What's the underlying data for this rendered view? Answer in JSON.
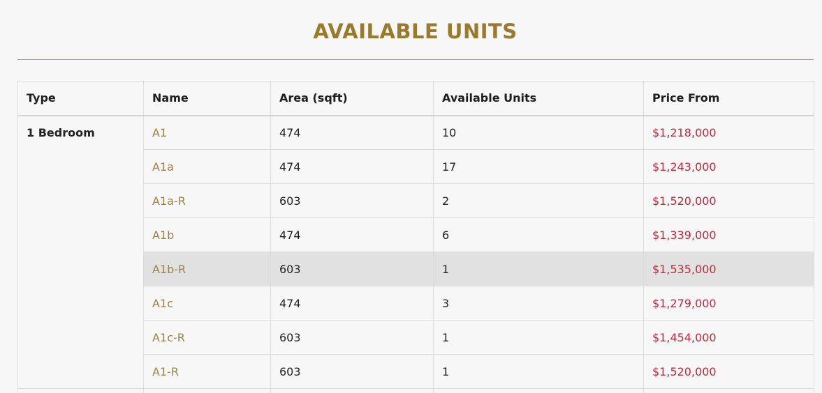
{
  "page": {
    "title": "AVAILABLE UNITS"
  },
  "table": {
    "headers": [
      "Type",
      "Name",
      "Area (sqft)",
      "Available Units",
      "Price From"
    ],
    "group_type": "1 Bedroom",
    "rows": [
      {
        "name": "A1",
        "area": "474",
        "units": "10",
        "price": "$1,218,000"
      },
      {
        "name": "A1a",
        "area": "474",
        "units": "17",
        "price": "$1,243,000"
      },
      {
        "name": "A1a-R",
        "area": "603",
        "units": "2",
        "price": "$1,520,000"
      },
      {
        "name": "A1b",
        "area": "474",
        "units": "6",
        "price": "$1,339,000"
      },
      {
        "name": "A1b-R",
        "area": "603",
        "units": "1",
        "price": "$1,535,000"
      },
      {
        "name": "A1c",
        "area": "474",
        "units": "3",
        "price": "$1,279,000"
      },
      {
        "name": "A1c-R",
        "area": "603",
        "units": "1",
        "price": "$1,454,000"
      },
      {
        "name": "A1-R",
        "area": "603",
        "units": "1",
        "price": "$1,520,000"
      }
    ]
  },
  "colors": {
    "title": "#9a7b2e",
    "link": "#9a8347",
    "price": "#c4283a",
    "highlight_row": "#e1e1e1"
  }
}
